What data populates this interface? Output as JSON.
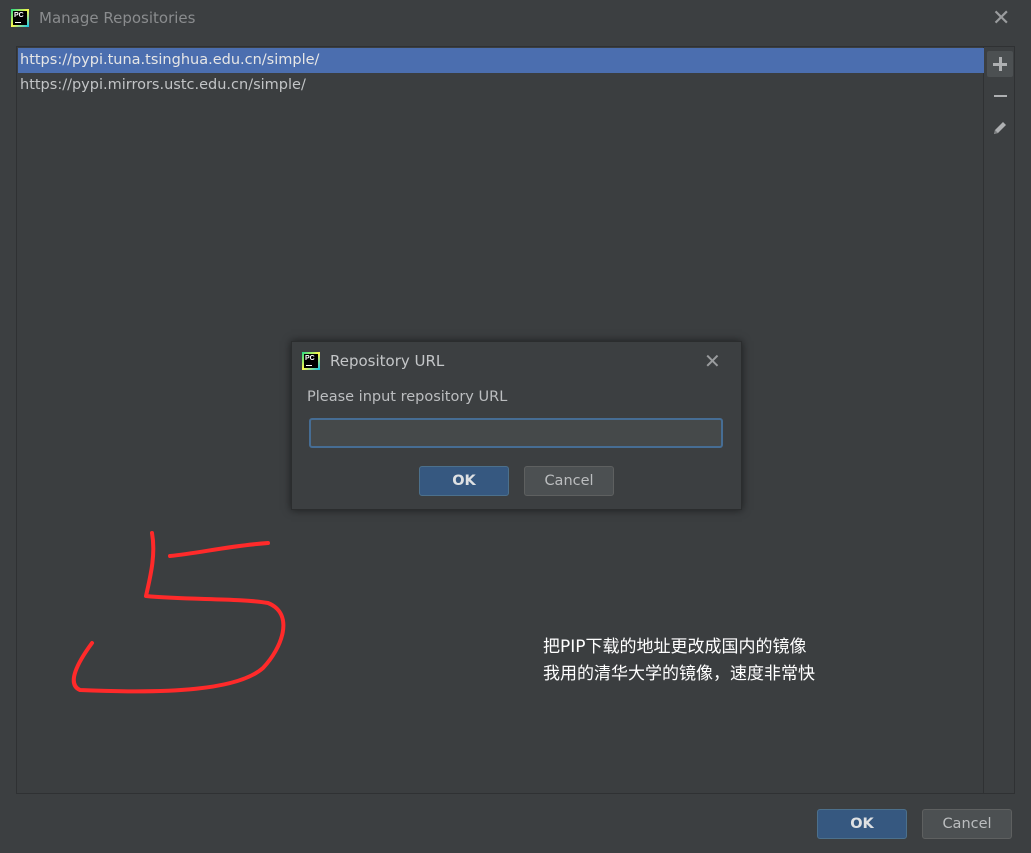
{
  "window": {
    "title": "Manage Repositories",
    "icon": "pycharm-icon",
    "icon_text": "PC",
    "close_glyph": "✕"
  },
  "repositories": [
    {
      "url": "https://pypi.tuna.tsinghua.edu.cn/simple/",
      "selected": true
    },
    {
      "url": "https://pypi.mirrors.ustc.edu.cn/simple/",
      "selected": false
    }
  ],
  "toolbar": {
    "add": "plus-icon",
    "remove": "minus-icon",
    "edit": "pencil-icon"
  },
  "dialog": {
    "title": "Repository URL",
    "prompt": "Please input repository URL",
    "input_value": "",
    "ok_label": "OK",
    "cancel_label": "Cancel"
  },
  "footer": {
    "ok_label": "OK",
    "cancel_label": "Cancel"
  },
  "annotation": {
    "handwritten_digit": "5",
    "stroke_color": "#ff2a2a",
    "note_lines": [
      "把PIP下载的地址更改成国内的镜像",
      "我用的清华大学的镜像，速度非常快"
    ]
  },
  "colors": {
    "background": "#3c3f41",
    "selection": "#4b6eaf",
    "primary_button": "#365880",
    "input_focus": "#466d94"
  }
}
